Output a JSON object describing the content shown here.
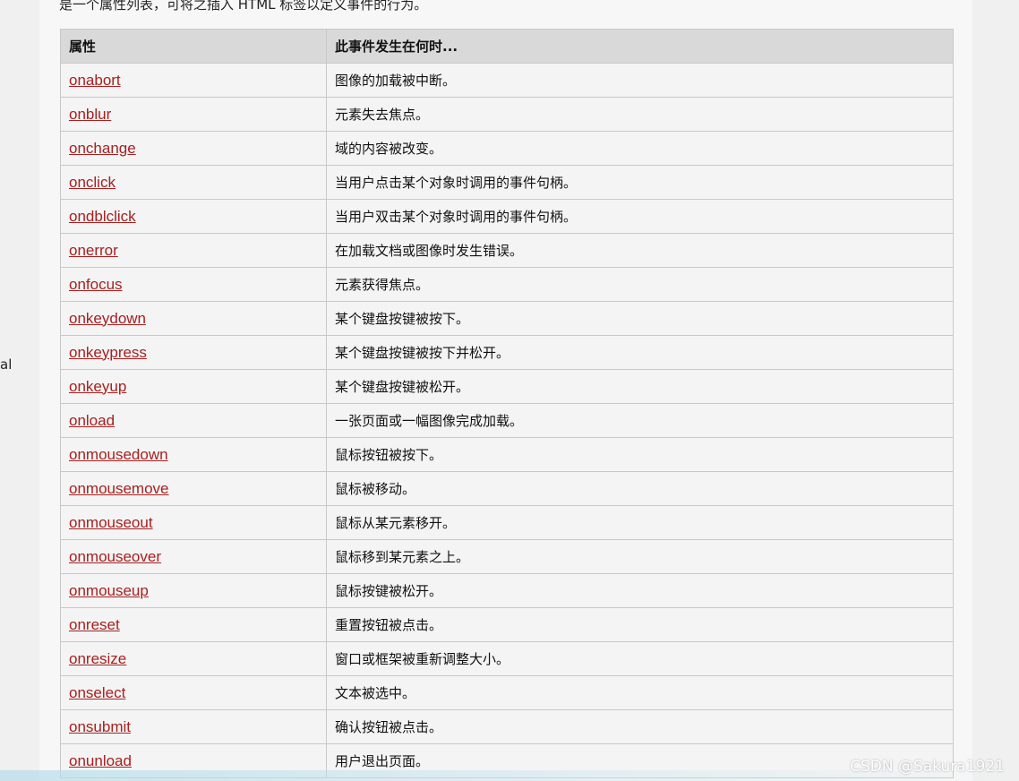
{
  "intro_text": "是一个属性列表，可将之插入 HTML 标签以定义事件的行为。",
  "side_fragment": "al",
  "table": {
    "headers": [
      "属性",
      "此事件发生在何时..."
    ],
    "rows": [
      {
        "attr": "onabort",
        "desc": "图像的加载被中断。"
      },
      {
        "attr": "onblur",
        "desc": "元素失去焦点。"
      },
      {
        "attr": "onchange",
        "desc": "域的内容被改变。"
      },
      {
        "attr": "onclick",
        "desc": "当用户点击某个对象时调用的事件句柄。"
      },
      {
        "attr": "ondblclick",
        "desc": "当用户双击某个对象时调用的事件句柄。"
      },
      {
        "attr": "onerror",
        "desc": "在加载文档或图像时发生错误。"
      },
      {
        "attr": "onfocus",
        "desc": "元素获得焦点。"
      },
      {
        "attr": "onkeydown",
        "desc": "某个键盘按键被按下。"
      },
      {
        "attr": "onkeypress",
        "desc": "某个键盘按键被按下并松开。"
      },
      {
        "attr": "onkeyup",
        "desc": "某个键盘按键被松开。"
      },
      {
        "attr": "onload",
        "desc": "一张页面或一幅图像完成加载。"
      },
      {
        "attr": "onmousedown",
        "desc": "鼠标按钮被按下。"
      },
      {
        "attr": "onmousemove",
        "desc": "鼠标被移动。"
      },
      {
        "attr": "onmouseout",
        "desc": "鼠标从某元素移开。"
      },
      {
        "attr": "onmouseover",
        "desc": "鼠标移到某元素之上。"
      },
      {
        "attr": "onmouseup",
        "desc": "鼠标按键被松开。"
      },
      {
        "attr": "onreset",
        "desc": "重置按钮被点击。"
      },
      {
        "attr": "onresize",
        "desc": "窗口或框架被重新调整大小。"
      },
      {
        "attr": "onselect",
        "desc": "文本被选中。"
      },
      {
        "attr": "onsubmit",
        "desc": "确认按钮被点击。"
      },
      {
        "attr": "onunload",
        "desc": "用户退出页面。"
      }
    ]
  },
  "watermark": "CSDN @Sakura1921",
  "colors": {
    "link": "#a82020",
    "header_bg": "#d9d9d9",
    "border": "#c8c8c8"
  }
}
